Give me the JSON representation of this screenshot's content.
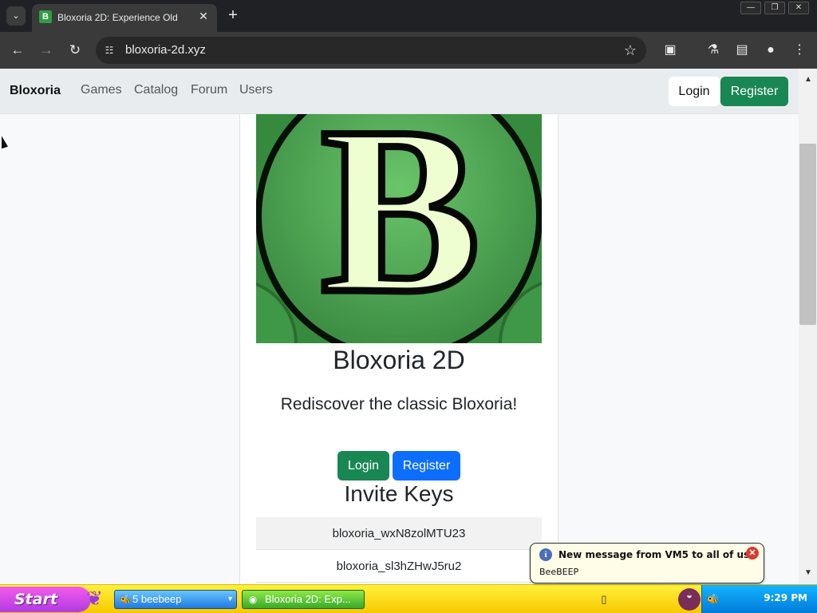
{
  "browser": {
    "tab_title": "Bloxoria 2D: Experience Old",
    "tab_favicon_letter": "B",
    "url": "bloxoria-2d.xyz",
    "icons": {
      "tab_search": "chevron-down-icon",
      "close": "close-icon",
      "new_tab": "plus-icon",
      "minimize": "minimize-icon",
      "restore": "restore-icon",
      "window_close": "close-icon",
      "back": "back-arrow-icon",
      "forward": "forward-arrow-icon",
      "reload": "reload-icon",
      "site_info": "site-info-icon",
      "bookmark": "star-icon",
      "extensions": "puzzle-icon",
      "labs": "flask-icon",
      "side_panel": "side-panel-icon",
      "profile": "profile-icon",
      "menu": "more-vertical-icon"
    }
  },
  "site_header": {
    "brand": "Bloxoria",
    "links": [
      "Games",
      "Catalog",
      "Forum",
      "Users"
    ],
    "login": "Login",
    "register": "Register",
    "colors": {
      "register": "#198754"
    }
  },
  "hero": {
    "logo_letter": "B",
    "title": "Bloxoria 2D",
    "subtitle": "Rediscover the classic Bloxoria!",
    "login": "Login",
    "register": "Register",
    "invite_heading": "Invite Keys",
    "invite_keys": [
      "bloxoria_wxN8zolMTU23",
      "bloxoria_sl3hZHwJ5ru2"
    ]
  },
  "notification": {
    "title": "New message from VM5 to all of us",
    "body": "BeeBEEP",
    "icon": "info-icon"
  },
  "taskbar": {
    "start": "Start",
    "task_beebeep": "5 beebeep",
    "task_browser": "Bloxoria 2D: Exp...",
    "clock": "9:29 PM",
    "icons": {
      "start_leaf": "start-leaf-icon",
      "beebeep": "bee-icon",
      "browser": "browser-icon",
      "tray_app": "tray-app-icon",
      "tray_chat": "chat-icon",
      "tray_beebeep": "bee-icon"
    }
  }
}
